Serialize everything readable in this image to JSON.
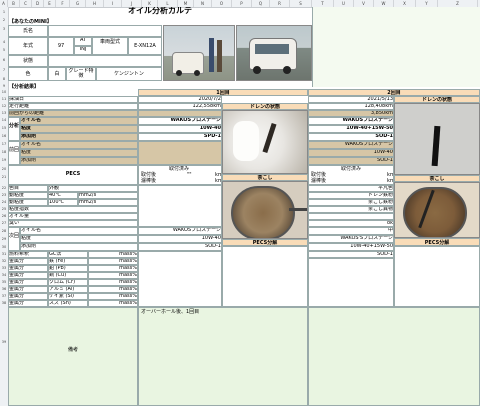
{
  "sheet": {
    "title": "オイル分析カルテ",
    "section_car": "【あなたのMINI】",
    "section_analysis": "【分析結果】"
  },
  "columns": [
    "A",
    "B",
    "C",
    "D",
    "E",
    "F",
    "G",
    "H",
    "I",
    "J",
    "K",
    "L",
    "M",
    "N",
    "O",
    "P",
    "Q",
    "R",
    "S",
    "T",
    "U",
    "V",
    "W",
    "X",
    "Y",
    "Z"
  ],
  "car": {
    "name_label": "氏名",
    "year_label": "年式",
    "year_value": "97",
    "type_code": "AT",
    "trans": "INJ",
    "model_label": "車両型式",
    "model_value": "E-XN12A",
    "status_label": "状態",
    "color_label": "色",
    "color_value": "白",
    "grade_label": "グレード特徴",
    "grade_value": "ケンジントン"
  },
  "rounds": [
    {
      "label": "1回目",
      "date": "2020/7/2",
      "odometer": "122,558km",
      "distance": "",
      "oil_name": "WAKOSプロステージ",
      "viscosity": "10W-40",
      "additive": "SPD-1",
      "drain_label": "ドレンの状態",
      "strainer_label": "茶こし",
      "pecs_label": "PECS分解",
      "acid_label": "取付済み",
      "acid_before": "取付後",
      "acid_before_val": "\"\"",
      "acid_before_unit": "km",
      "acid_replace": "濾棒後",
      "acid_replace_unit": "km",
      "result_oil": "WAKOSプロステージ",
      "result_visc": "10W-40",
      "result_add": "SOD-1"
    },
    {
      "label": "2回目",
      "date": "2021/5/13",
      "odometer": "128,408km",
      "distance": "3,850km",
      "oil_name": "WAKOSプロステージ",
      "viscosity": "10W-40+15W-50",
      "additive": "SOD-1",
      "drain_label": "ドレンの状態",
      "strainer_label": "茶こし",
      "pecs_label": "PECS分解",
      "acid_label": "取付済み",
      "acid_before": "取付後",
      "acid_before_unit": "km",
      "acid_replace": "濾棒後",
      "acid_replace_unit": "km",
      "prev_oil": "WAKOSプロステージ",
      "prev_visc": "10W-40",
      "prev_add": "SOD-1",
      "appearance": "平凡色",
      "drain_note": "ドレン鉄粉",
      "strainer_note": "茶こし鉄粉",
      "strainer_note2": "茶こし異物",
      "ok": "ok",
      "mid": "中",
      "result_oil": "WAKOS'Sプロステージ",
      "result_visc": "10W-40+15W-50",
      "result_add": "SOD-1"
    }
  ],
  "rows": {
    "date": "採油日",
    "odometer": "走行距離",
    "prev_distance": "前回からの距離",
    "oil_label": "オイル名",
    "viscosity": "粘度",
    "additive": "添加剤",
    "side_usage": "分析",
    "side_prev": "前回",
    "side_next": "次回",
    "pecs": "PECS",
    "color": "色目",
    "appearance": "外観",
    "viscosity_40": "動粘度",
    "temp_40": "40℃",
    "unit_visc": "mm2/s",
    "viscosity_100": "動粘度",
    "temp_100": "100℃",
    "vi": "粘度指数",
    "oil_state": "オイル量",
    "smell": "臭い",
    "total_base": "全塩基価",
    "sludge": "GC法",
    "metal_fe": "鉄 (Fe)",
    "metal_pb": "鉛 (Pb)",
    "metal_cu": "銅 (Cu)",
    "metal_cr": "クロム (Cr)",
    "metal_al": "アルミ (Al)",
    "metal_si": "ケイ素 (Si)",
    "metal_sn": "スズ (Sn)",
    "unit_mass": "mass%",
    "unit_ppm": "mass%",
    "metal": "金属分",
    "fuel": "燃料希釈",
    "remark_label": "備考",
    "remark_text": "オーバーホール後、1回目"
  }
}
